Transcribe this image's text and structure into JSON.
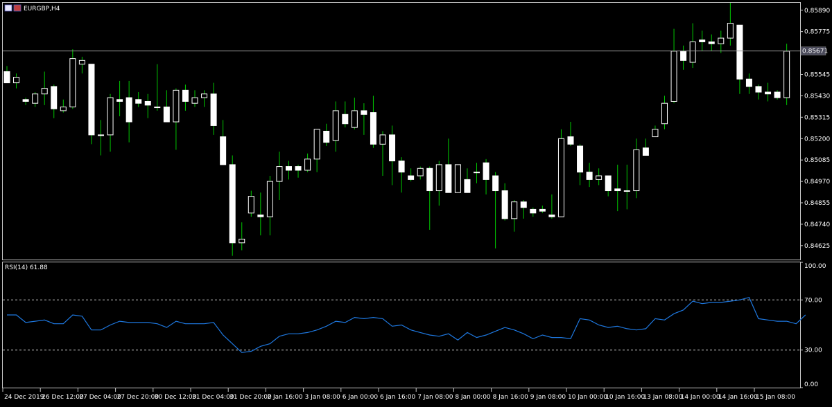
{
  "window": {
    "symbol_label": "EURGBP,H4"
  },
  "indicator": {
    "label": "RSI(14) 61.88"
  },
  "colors": {
    "background": "#000000",
    "frame": "#c8c8c8",
    "wick": "#00c800",
    "bull_body": "#000000",
    "bear_body": "#ffffff",
    "candle_edge": "#ffffff",
    "current_price_line": "#9a9a9a",
    "current_price_box": "#4a4a5a",
    "rsi_line": "#1e78e0",
    "rsi_levels": "#c8c8c8"
  },
  "chart_data": [
    {
      "type": "candlestick",
      "title": "EURGBP,H4",
      "ylim": [
        0.8455,
        0.8593
      ],
      "yticks": [
        0.8589,
        0.85775,
        0.85545,
        0.8543,
        0.85315,
        0.852,
        0.85085,
        0.8497,
        0.84855,
        0.8474,
        0.84625
      ],
      "ytick_labels": [
        "0.85890",
        "0.85775",
        "0.85545",
        "0.85430",
        "0.85315",
        "0.85200",
        "0.85085",
        "0.84970",
        "0.84855",
        "0.84740",
        "0.84625"
      ],
      "current_price": 0.85671,
      "current_price_label": "0.85671",
      "xtick_labels": [
        "24 Dec 2019",
        "26 Dec 12:00",
        "27 Dec 04:00",
        "27 Dec 20:00",
        "30 Dec 12:00",
        "31 Dec 04:00",
        "31 Dec 20:00",
        "2 Jan 16:00",
        "3 Jan 08:00",
        "6 Jan 00:00",
        "6 Jan 16:00",
        "7 Jan 08:00",
        "8 Jan 00:00",
        "8 Jan 16:00",
        "9 Jan 08:00",
        "10 Jan 00:00",
        "10 Jan 16:00",
        "13 Jan 08:00",
        "14 Jan 00:00",
        "14 Jan 16:00",
        "15 Jan 08:00"
      ],
      "xtick_candle_index": [
        0,
        4,
        8,
        12,
        16,
        20,
        24,
        28,
        32,
        36,
        40,
        44,
        48,
        52,
        56,
        60,
        64,
        68,
        72,
        76,
        80
      ],
      "candles": [
        {
          "o": 0.8556,
          "h": 0.8559,
          "l": 0.855,
          "c": 0.855
        },
        {
          "o": 0.855,
          "h": 0.8555,
          "l": 0.8547,
          "c": 0.8553
        },
        {
          "o": 0.8541,
          "h": 0.8542,
          "l": 0.8538,
          "c": 0.854
        },
        {
          "o": 0.8539,
          "h": 0.8545,
          "l": 0.8537,
          "c": 0.8544
        },
        {
          "o": 0.8544,
          "h": 0.8556,
          "l": 0.8538,
          "c": 0.8547
        },
        {
          "o": 0.8548,
          "h": 0.8549,
          "l": 0.8531,
          "c": 0.8536
        },
        {
          "o": 0.8535,
          "h": 0.8541,
          "l": 0.8534,
          "c": 0.8537
        },
        {
          "o": 0.8537,
          "h": 0.8568,
          "l": 0.8536,
          "c": 0.8563
        },
        {
          "o": 0.856,
          "h": 0.8564,
          "l": 0.8555,
          "c": 0.8562
        },
        {
          "o": 0.856,
          "h": 0.856,
          "l": 0.8517,
          "c": 0.8522
        },
        {
          "o": 0.8522,
          "h": 0.853,
          "l": 0.8511,
          "c": 0.8522
        },
        {
          "o": 0.8522,
          "h": 0.8544,
          "l": 0.8513,
          "c": 0.8542
        },
        {
          "o": 0.8541,
          "h": 0.8551,
          "l": 0.8532,
          "c": 0.854
        },
        {
          "o": 0.8542,
          "h": 0.8551,
          "l": 0.8518,
          "c": 0.8529
        },
        {
          "o": 0.8541,
          "h": 0.8545,
          "l": 0.8537,
          "c": 0.8539
        },
        {
          "o": 0.854,
          "h": 0.8544,
          "l": 0.8531,
          "c": 0.8538
        },
        {
          "o": 0.8537,
          "h": 0.856,
          "l": 0.8535,
          "c": 0.8537
        },
        {
          "o": 0.8537,
          "h": 0.8546,
          "l": 0.8529,
          "c": 0.8529
        },
        {
          "o": 0.8529,
          "h": 0.8547,
          "l": 0.8514,
          "c": 0.8546
        },
        {
          "o": 0.8546,
          "h": 0.8549,
          "l": 0.8535,
          "c": 0.854
        },
        {
          "o": 0.8539,
          "h": 0.8546,
          "l": 0.8537,
          "c": 0.8542
        },
        {
          "o": 0.8542,
          "h": 0.8546,
          "l": 0.8537,
          "c": 0.8544
        },
        {
          "o": 0.8544,
          "h": 0.855,
          "l": 0.8522,
          "c": 0.8527
        },
        {
          "o": 0.8521,
          "h": 0.853,
          "l": 0.8506,
          "c": 0.8506
        },
        {
          "o": 0.8506,
          "h": 0.8511,
          "l": 0.8457,
          "c": 0.8464
        },
        {
          "o": 0.8464,
          "h": 0.8475,
          "l": 0.846,
          "c": 0.8466
        },
        {
          "o": 0.848,
          "h": 0.8492,
          "l": 0.8478,
          "c": 0.8489
        },
        {
          "o": 0.8479,
          "h": 0.8491,
          "l": 0.8468,
          "c": 0.8478
        },
        {
          "o": 0.8478,
          "h": 0.85,
          "l": 0.8468,
          "c": 0.8497
        },
        {
          "o": 0.8497,
          "h": 0.8513,
          "l": 0.8487,
          "c": 0.8505
        },
        {
          "o": 0.8505,
          "h": 0.8508,
          "l": 0.8498,
          "c": 0.8503
        },
        {
          "o": 0.8505,
          "h": 0.8506,
          "l": 0.8499,
          "c": 0.8503
        },
        {
          "o": 0.8503,
          "h": 0.8512,
          "l": 0.8502,
          "c": 0.8509
        },
        {
          "o": 0.8509,
          "h": 0.8523,
          "l": 0.8502,
          "c": 0.8525
        },
        {
          "o": 0.8524,
          "h": 0.8528,
          "l": 0.8516,
          "c": 0.8518
        },
        {
          "o": 0.8519,
          "h": 0.854,
          "l": 0.8513,
          "c": 0.8535
        },
        {
          "o": 0.8533,
          "h": 0.854,
          "l": 0.8526,
          "c": 0.8528
        },
        {
          "o": 0.8526,
          "h": 0.8542,
          "l": 0.8525,
          "c": 0.8535
        },
        {
          "o": 0.8535,
          "h": 0.8539,
          "l": 0.8522,
          "c": 0.8533
        },
        {
          "o": 0.8534,
          "h": 0.8543,
          "l": 0.8515,
          "c": 0.8517
        },
        {
          "o": 0.8517,
          "h": 0.8524,
          "l": 0.85,
          "c": 0.8522
        },
        {
          "o": 0.8522,
          "h": 0.8527,
          "l": 0.8495,
          "c": 0.8508
        },
        {
          "o": 0.8508,
          "h": 0.851,
          "l": 0.8491,
          "c": 0.8502
        },
        {
          "o": 0.85,
          "h": 0.8504,
          "l": 0.8497,
          "c": 0.8498
        },
        {
          "o": 0.85,
          "h": 0.8505,
          "l": 0.8498,
          "c": 0.8504
        },
        {
          "o": 0.8504,
          "h": 0.8505,
          "l": 0.8471,
          "c": 0.8492
        },
        {
          "o": 0.8492,
          "h": 0.8508,
          "l": 0.8484,
          "c": 0.8506
        },
        {
          "o": 0.8506,
          "h": 0.852,
          "l": 0.8491,
          "c": 0.8491
        },
        {
          "o": 0.8491,
          "h": 0.8506,
          "l": 0.8491,
          "c": 0.8506
        },
        {
          "o": 0.8498,
          "h": 0.8504,
          "l": 0.8491,
          "c": 0.8491
        },
        {
          "o": 0.8502,
          "h": 0.8507,
          "l": 0.8496,
          "c": 0.8502
        },
        {
          "o": 0.8507,
          "h": 0.8509,
          "l": 0.849,
          "c": 0.8498
        },
        {
          "o": 0.85,
          "h": 0.8502,
          "l": 0.8461,
          "c": 0.8492
        },
        {
          "o": 0.8492,
          "h": 0.8496,
          "l": 0.8476,
          "c": 0.8477
        },
        {
          "o": 0.8477,
          "h": 0.8487,
          "l": 0.847,
          "c": 0.8486
        },
        {
          "o": 0.8486,
          "h": 0.8487,
          "l": 0.8477,
          "c": 0.8483
        },
        {
          "o": 0.8482,
          "h": 0.8483,
          "l": 0.8478,
          "c": 0.848
        },
        {
          "o": 0.8482,
          "h": 0.8484,
          "l": 0.848,
          "c": 0.8481
        },
        {
          "o": 0.8479,
          "h": 0.849,
          "l": 0.8477,
          "c": 0.8478
        },
        {
          "o": 0.8478,
          "h": 0.8525,
          "l": 0.8478,
          "c": 0.852
        },
        {
          "o": 0.8521,
          "h": 0.8529,
          "l": 0.8516,
          "c": 0.8517
        },
        {
          "o": 0.8516,
          "h": 0.8517,
          "l": 0.8495,
          "c": 0.8502
        },
        {
          "o": 0.8502,
          "h": 0.8507,
          "l": 0.8494,
          "c": 0.8498
        },
        {
          "o": 0.8498,
          "h": 0.8504,
          "l": 0.8495,
          "c": 0.85
        },
        {
          "o": 0.85,
          "h": 0.85,
          "l": 0.8489,
          "c": 0.8492
        },
        {
          "o": 0.8493,
          "h": 0.8506,
          "l": 0.8481,
          "c": 0.8492
        },
        {
          "o": 0.8492,
          "h": 0.8506,
          "l": 0.8482,
          "c": 0.8492
        },
        {
          "o": 0.8492,
          "h": 0.852,
          "l": 0.8488,
          "c": 0.8514
        },
        {
          "o": 0.8515,
          "h": 0.852,
          "l": 0.8511,
          "c": 0.8511
        },
        {
          "o": 0.8521,
          "h": 0.8527,
          "l": 0.8521,
          "c": 0.8525
        },
        {
          "o": 0.8528,
          "h": 0.8543,
          "l": 0.8525,
          "c": 0.8539
        },
        {
          "o": 0.854,
          "h": 0.8579,
          "l": 0.8539,
          "c": 0.8567
        },
        {
          "o": 0.8567,
          "h": 0.857,
          "l": 0.8557,
          "c": 0.8562
        },
        {
          "o": 0.8561,
          "h": 0.8582,
          "l": 0.8558,
          "c": 0.8572
        },
        {
          "o": 0.8573,
          "h": 0.8578,
          "l": 0.8567,
          "c": 0.8572
        },
        {
          "o": 0.8572,
          "h": 0.8576,
          "l": 0.8567,
          "c": 0.8571
        },
        {
          "o": 0.8571,
          "h": 0.8578,
          "l": 0.8566,
          "c": 0.8574
        },
        {
          "o": 0.8574,
          "h": 0.8593,
          "l": 0.857,
          "c": 0.8582
        },
        {
          "o": 0.8581,
          "h": 0.8581,
          "l": 0.8544,
          "c": 0.8552
        },
        {
          "o": 0.8552,
          "h": 0.8555,
          "l": 0.8544,
          "c": 0.8548
        },
        {
          "o": 0.8548,
          "h": 0.8549,
          "l": 0.8541,
          "c": 0.8545
        },
        {
          "o": 0.8545,
          "h": 0.855,
          "l": 0.854,
          "c": 0.8544
        },
        {
          "o": 0.8545,
          "h": 0.8546,
          "l": 0.8541,
          "c": 0.8542
        },
        {
          "o": 0.8542,
          "h": 0.8571,
          "l": 0.8538,
          "c": 0.8567
        }
      ]
    },
    {
      "type": "line",
      "title": "RSI(14) 61.88",
      "ylim": [
        0,
        100
      ],
      "yticks": [
        100,
        70,
        30,
        0
      ],
      "ytick_labels": [
        "100.00",
        "70.00",
        "30.00",
        "0.00"
      ],
      "levels": [
        70,
        30
      ],
      "series": [
        {
          "values": [
            58,
            58,
            52,
            53,
            54,
            51,
            51,
            58,
            57,
            46,
            46,
            50,
            53,
            52,
            52,
            52,
            51,
            48,
            53,
            51,
            51,
            51,
            52,
            42,
            35,
            28,
            29,
            33,
            35,
            41,
            43,
            43,
            44,
            46,
            49,
            53,
            52,
            56,
            55,
            56,
            55,
            49,
            50,
            46,
            44,
            42,
            41,
            43,
            38,
            44,
            40,
            42,
            45,
            48,
            46,
            43,
            39,
            42,
            40,
            40,
            39,
            55,
            54,
            50,
            48,
            49,
            47,
            46,
            47,
            55,
            54,
            59,
            62,
            69,
            67,
            68,
            68,
            69,
            70,
            72,
            55,
            54,
            53,
            53,
            51,
            58
          ]
        }
      ]
    }
  ]
}
